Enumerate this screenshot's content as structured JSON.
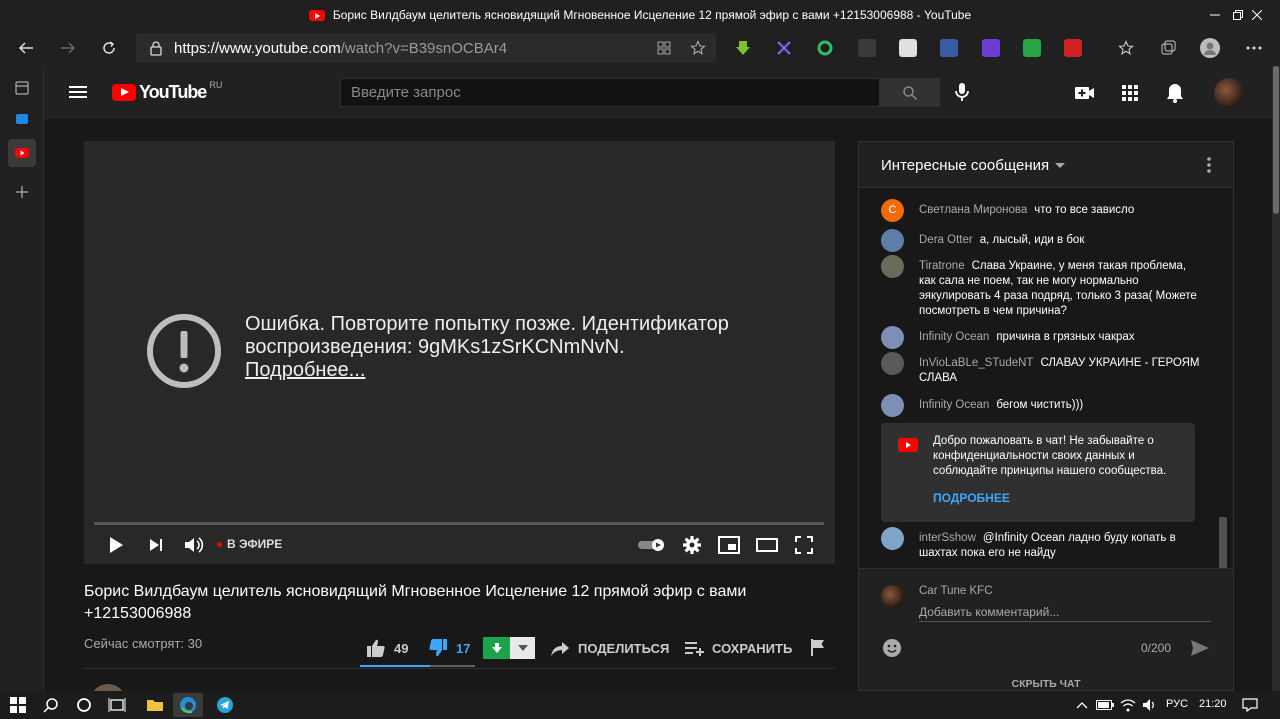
{
  "browser": {
    "tab_title": "Борис Вилдбаум целитель ясновидящий Мгновенное Исцеление 12 прямой эфир с вами +12153006988 - YouTube",
    "url_main": "https://www.youtube.com",
    "url_rest": "/watch?v=B39snOCBAr4"
  },
  "masthead": {
    "logo_word": "YouTube",
    "logo_region": "RU",
    "search_placeholder": "Введите запрос"
  },
  "player": {
    "error_message": "Ошибка. Повторите попытку позже. Идентификатор воспроизведения: 9gMKs1zSrKCNmNvN.",
    "error_link": "Подробнее...",
    "live_label": "В ЭФИРЕ"
  },
  "video": {
    "title": "Борис Вилдбаум целитель ясновидящий Мгновенное Исцеление 12 прямой эфир с вами +12153006988",
    "viewers": "Сейчас смотрят: 30",
    "likes": "49",
    "dislikes": "17",
    "share_label": "ПОДЕЛИТЬСЯ",
    "save_label": "СОХРАНИТЬ"
  },
  "chat": {
    "header": "Интересные сообщения",
    "messages": [
      {
        "author": "Светлана Миронова",
        "text": "что то все зависло",
        "avatar_letter": "С",
        "avatar_color": "#ef6c00"
      },
      {
        "author": "Dera Otter",
        "text": "а, лысый, иди в бок",
        "avatar_color": "#5b7fa8"
      },
      {
        "author": "Tiratrone",
        "text": "Слава Украине, у меня такая проблема, как сала не поем, так не могу нормально эякулировать 4 раза подряд, только 3 раза( Можете посмотреть в чем причина?",
        "avatar_color": "#6b6b5a"
      },
      {
        "author": "Infinity Ocean",
        "text": "причина в грязных чакрах",
        "avatar_color": "#7d8fb5"
      },
      {
        "author": "InVioLaBLe_STudeNT",
        "text": "СЛАВАУ УКРАИНЕ - ГЕРОЯМ СЛАВА",
        "avatar_color": "#5a5a5a"
      },
      {
        "author": "Infinity Ocean",
        "text": "бегом чистить)))",
        "avatar_color": "#7d8fb5"
      },
      {
        "author": "interSshow",
        "text": "@Infinity Ocean ладно буду копать в шахтах пока его не найду",
        "avatar_color": "#7ea5c8"
      }
    ],
    "welcome_text": "Добро пожаловать в чат! Не забывайте о конфиденциальности своих данных и соблюдайте принципы нашего сообщества.",
    "welcome_link": "ПОДРОБНЕЕ",
    "user_name": "Car Tune KFC",
    "input_placeholder": "Добавить комментарий...",
    "counter": "0/200",
    "hide_label": "СКРЫТЬ ЧАТ"
  },
  "taskbar": {
    "language": "РУС",
    "time": "21:20"
  },
  "colors": {
    "accent_red": "#ff0000",
    "link_blue": "#3ea6ff",
    "download_green": "#1aa34a"
  }
}
